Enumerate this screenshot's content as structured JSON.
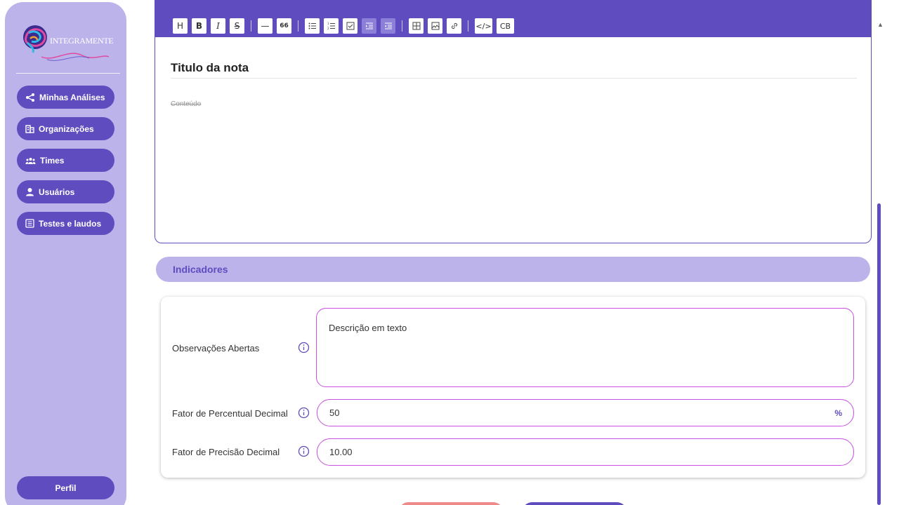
{
  "brand": {
    "name": "INTEGRAMENTE"
  },
  "colors": {
    "primary": "#5f4cbf",
    "sidebar_bg": "#bcb3ea",
    "field_border": "#c84fe0",
    "danger": "#ef8a8a"
  },
  "sidebar": {
    "items": [
      {
        "label": "Minhas Análises",
        "icon": "share-icon"
      },
      {
        "label": "Organizações",
        "icon": "building-icon"
      },
      {
        "label": "Times",
        "icon": "group-icon"
      },
      {
        "label": "Usuários",
        "icon": "user-icon"
      },
      {
        "label": "Testes e laudos",
        "icon": "list-doc-icon"
      }
    ],
    "profile_label": "Perfil"
  },
  "toolbar": {
    "heading": "H",
    "bold": "B",
    "italic": "I",
    "strike": "S",
    "hr": "—",
    "quote": "66",
    "code_inline": "</>",
    "code_block": "CB"
  },
  "editor": {
    "title": "Titulo da nota",
    "content_placeholder": "Conteúdo"
  },
  "indicators": {
    "header": "Indicadores",
    "fields": {
      "observacoes": {
        "label": "Observações Abertas",
        "value": "Descrição em texto"
      },
      "percentual": {
        "label": "Fator de Percentual Decimal",
        "value": "50",
        "suffix": "%"
      },
      "precisao": {
        "label": "Fator de Precisão Decimal",
        "value": "10.00"
      }
    }
  }
}
